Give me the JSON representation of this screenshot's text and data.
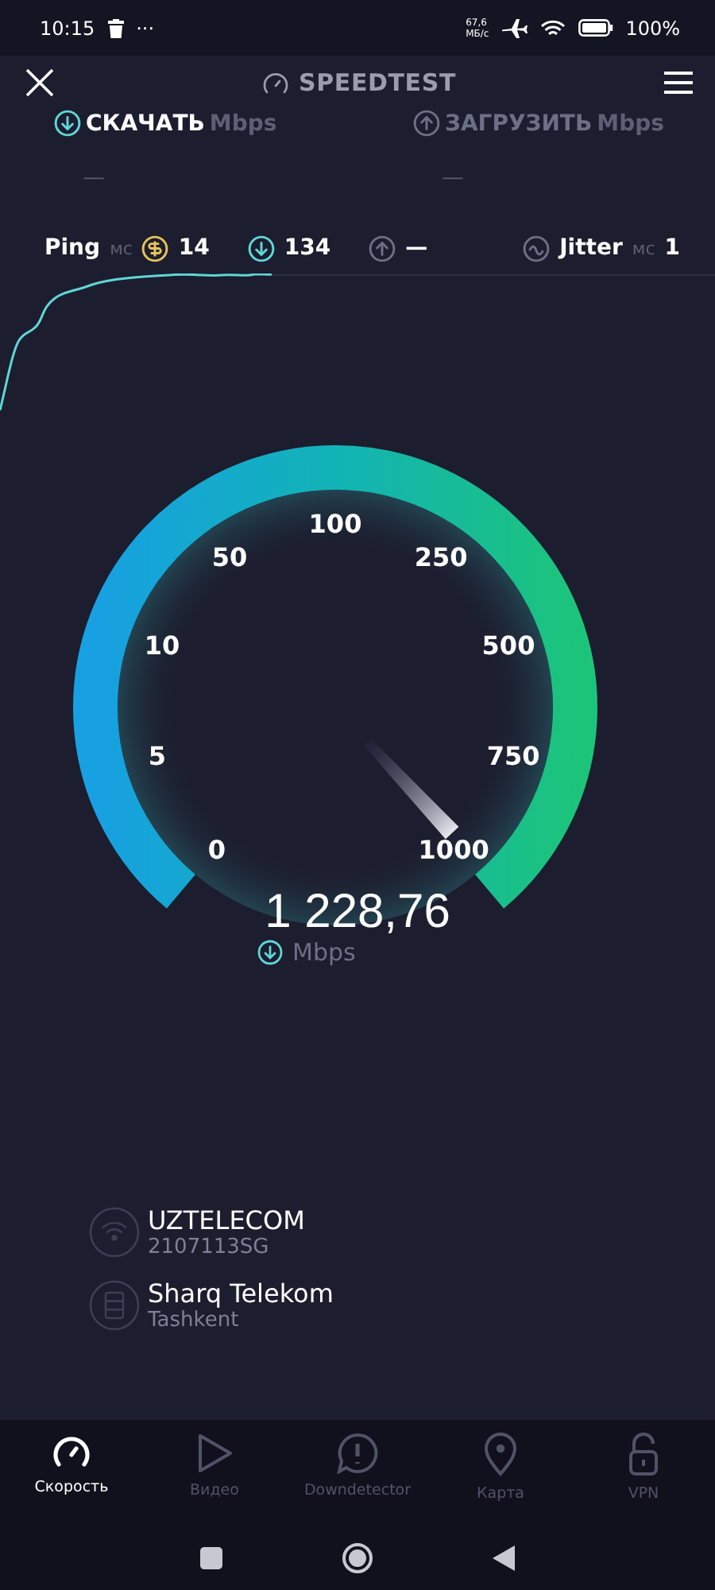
{
  "status_bar": {
    "time": "10:15",
    "more": "···",
    "net_speed_value": "67,6",
    "net_speed_unit": "МБ/с",
    "battery": "100%"
  },
  "header": {
    "title": "SPEEDTEST"
  },
  "tests": [
    {
      "kind": "download",
      "label": "СКАЧАТЬ",
      "unit": "Mbps",
      "value": "—",
      "selected": true
    },
    {
      "kind": "upload",
      "label": "ЗАГРУЗИТЬ",
      "unit": "Mbps",
      "value": "—",
      "selected": false
    }
  ],
  "stats": {
    "ping_label": "Ping",
    "ping_unit": "мс",
    "idle": "14",
    "download": "134",
    "upload": "—",
    "jitter_label": "Jitter",
    "jitter_unit": "мс",
    "jitter": "1"
  },
  "gauge": {
    "scale": [
      "0",
      "5",
      "10",
      "50",
      "100",
      "250",
      "500",
      "750",
      "1000"
    ],
    "value": "1 228,76",
    "unit": "Mbps"
  },
  "connection": [
    {
      "kind": "wifi",
      "name": "UZTELECOM",
      "detail": "2107113SG"
    },
    {
      "kind": "server",
      "name": "Sharq Telekom",
      "detail": "Tashkent"
    }
  ],
  "nav": [
    {
      "kind": "speed",
      "label": "Скорость",
      "selected": true
    },
    {
      "kind": "video",
      "label": "Видео",
      "selected": false
    },
    {
      "kind": "alert",
      "label": "Downdetector",
      "selected": false
    },
    {
      "kind": "map",
      "label": "Карта",
      "selected": false
    },
    {
      "kind": "vpn",
      "label": "VPN",
      "selected": false
    }
  ]
}
